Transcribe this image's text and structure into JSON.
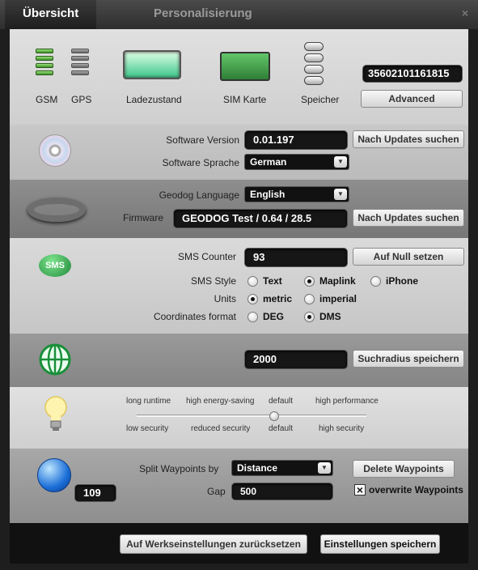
{
  "tabs": [
    {
      "label": "Übersicht"
    },
    {
      "label": "Personalisierung"
    }
  ],
  "status": {
    "gsm_label": "GSM",
    "gps_label": "GPS",
    "battery_label": "Ladezustand",
    "sim_label": "SIM Karte",
    "memory_label": "Speicher",
    "serial": "35602101161815",
    "advanced_label": "Advanced"
  },
  "software": {
    "version_label": "Software Version",
    "version_value": "0.01.197",
    "update_label": "Nach Updates suchen",
    "language_label": "Software Sprache",
    "language_value": "German"
  },
  "geodog": {
    "language_label": "Geodog Language",
    "language_value": "English",
    "firmware_label": "Firmware",
    "firmware_value": "GEODOG Test / 0.64 / 28.5",
    "update_label": "Nach Updates suchen"
  },
  "sms": {
    "icon_text": "SMS",
    "counter_label": "SMS Counter",
    "counter_value": "93",
    "reset_label": "Auf Null setzen",
    "style_label": "SMS Style",
    "style_options": [
      "Text",
      "Maplink",
      "iPhone"
    ],
    "style_selected": "Maplink",
    "units_label": "Units",
    "units_options": [
      "metric",
      "imperial"
    ],
    "units_selected": "metric",
    "coords_label": "Coordinates format",
    "coords_options": [
      "DEG",
      "DMS"
    ],
    "coords_selected": "DMS"
  },
  "search": {
    "radius_value": "2000",
    "save_label": "Suchradius speichern"
  },
  "energy": {
    "top_labels": [
      "long runtime",
      "high energy-saving",
      "default",
      "high performance"
    ],
    "bottom_labels": [
      "low security",
      "reduced security",
      "default",
      "high security"
    ],
    "level_fraction": 0.6
  },
  "waypoints": {
    "count": "109",
    "split_label": "Split Waypoints by",
    "split_value": "Distance",
    "gap_label": "Gap",
    "gap_value": "500",
    "delete_label": "Delete Waypoints",
    "overwrite_label": "overwrite Waypoints",
    "overwrite_checked": true
  },
  "footer": {
    "reset_label": "Auf Werkseinstellungen zurücksetzen",
    "save_label": "Einstellungen speichern"
  }
}
